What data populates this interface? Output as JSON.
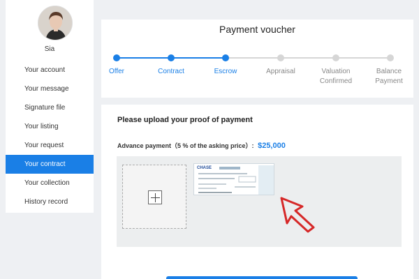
{
  "sidebar": {
    "user_name": "Sia",
    "items": [
      {
        "label": "Your account"
      },
      {
        "label": "Your message"
      },
      {
        "label": "Signature file"
      },
      {
        "label": "Your listing"
      },
      {
        "label": "Your request"
      },
      {
        "label": "Your contract",
        "active": true
      },
      {
        "label": "Your collection"
      },
      {
        "label": "History record"
      }
    ]
  },
  "voucher": {
    "title": "Payment voucher",
    "steps": [
      {
        "label": "Offer",
        "done": true
      },
      {
        "label": "Contract",
        "done": true
      },
      {
        "label": "Escrow",
        "done": true
      },
      {
        "label": "Appraisal",
        "done": false
      },
      {
        "label": "Valuation Confirmed",
        "done": false
      },
      {
        "label": "Balance Payment",
        "done": false
      }
    ]
  },
  "upload": {
    "title": "Please upload your proof of payment",
    "advance_label": "Advance payment（5 % of the asking price）:",
    "advance_amount": "$25,000",
    "cheque_bank": "CHASE"
  },
  "colors": {
    "accent": "#1a7fe6",
    "inactive": "#d6d6d6",
    "cursor": "#d62828"
  }
}
